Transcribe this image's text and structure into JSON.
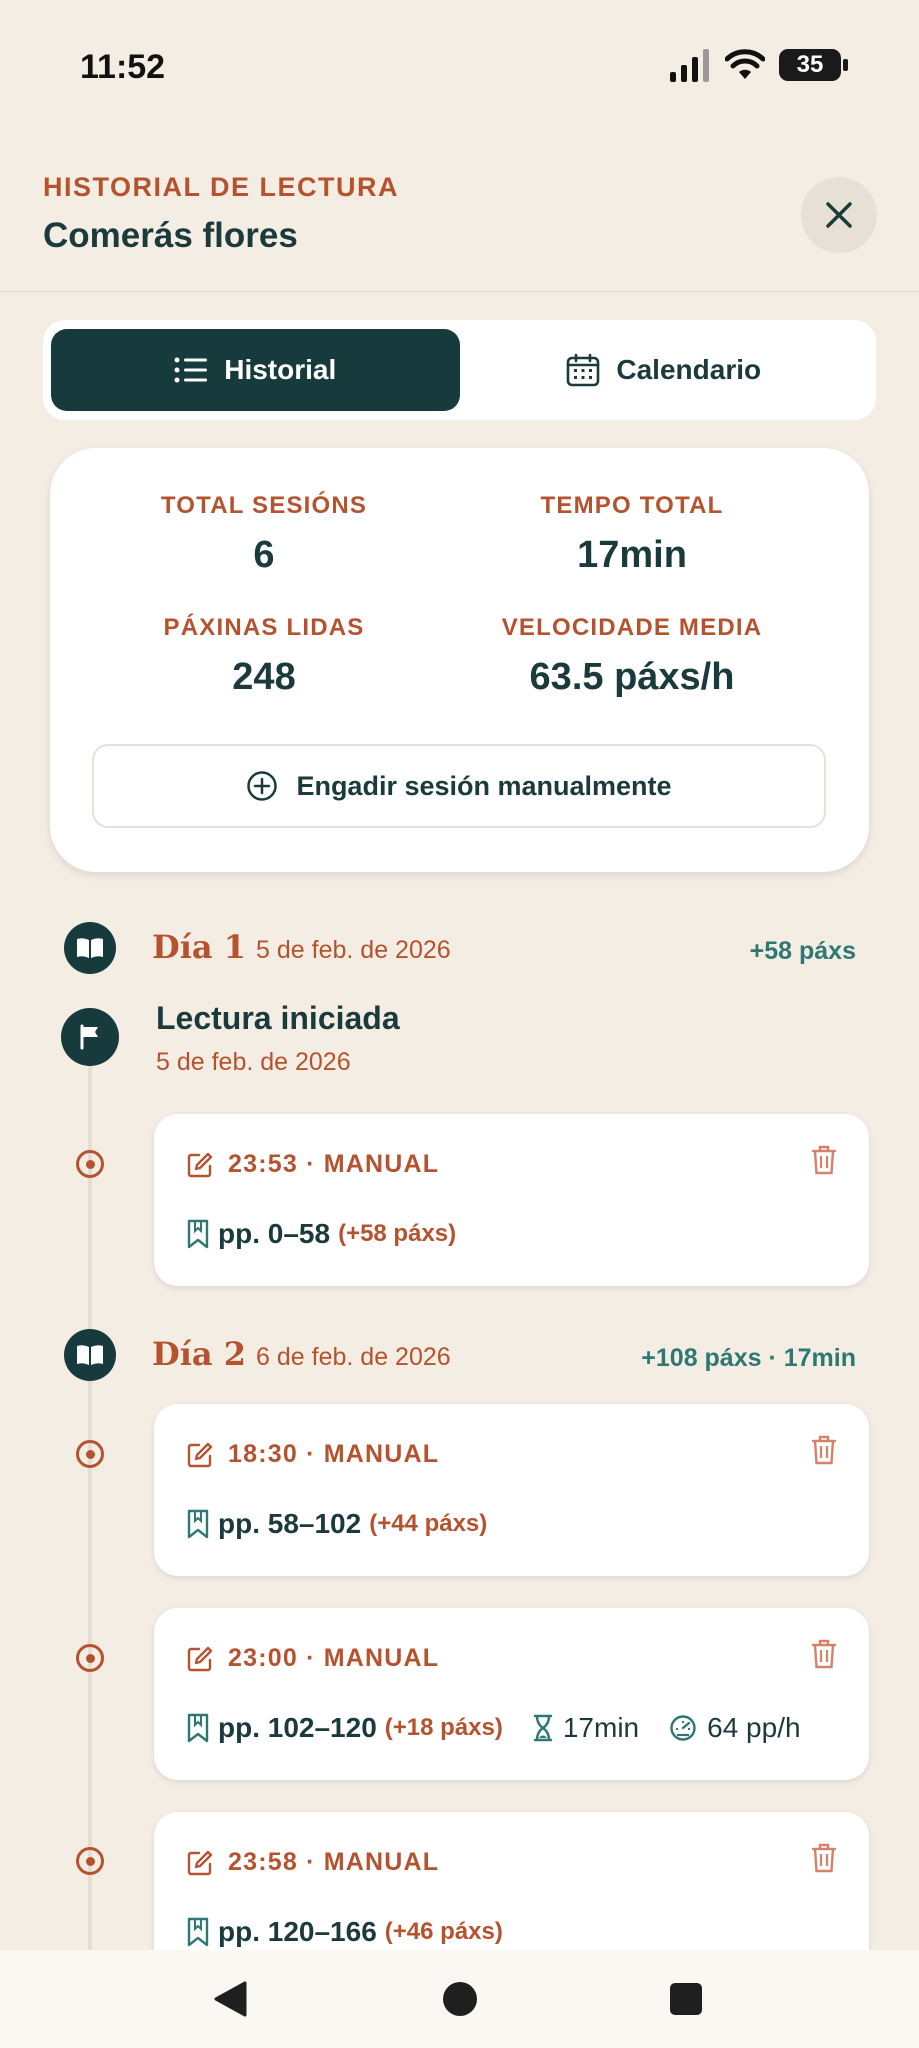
{
  "status_bar": {
    "time": "11:52",
    "battery": "35"
  },
  "header": {
    "kicker": "HISTORIAL DE LECTURA",
    "title": "Comerás flores"
  },
  "tabs": [
    {
      "label": "Historial",
      "icon": "list-icon",
      "active": true
    },
    {
      "label": "Calendario",
      "icon": "calendar-icon",
      "active": false
    }
  ],
  "stats": {
    "total_sessions": {
      "label": "TOTAL SESIÓNS",
      "value": "6"
    },
    "total_time": {
      "label": "TEMPO TOTAL",
      "value": "17min"
    },
    "pages_read": {
      "label": "PÁXINAS LIDAS",
      "value": "248"
    },
    "avg_speed": {
      "label": "VELOCIDADE MEDIA",
      "value": "63.5 páxs/h"
    }
  },
  "add_session_label": "Engadir sesión manualmente",
  "days": [
    {
      "title": "Día 1",
      "date": "5 de feb. de 2026",
      "summary": "+58 páxs",
      "start": {
        "title": "Lectura iniciada",
        "date": "5 de feb. de 2026"
      },
      "sessions": [
        {
          "header": "23:53 · MANUAL",
          "pages": "pp. 0–58",
          "delta": "(+58 páxs)"
        }
      ]
    },
    {
      "title": "Día 2",
      "date": "6 de feb. de 2026",
      "summary": "+108 páxs · 17min",
      "sessions": [
        {
          "header": "18:30 · MANUAL",
          "pages": "pp. 58–102",
          "delta": "(+44 páxs)"
        },
        {
          "header": "23:00 · MANUAL",
          "pages": "pp. 102–120",
          "delta": "(+18 páxs)",
          "duration": "17min",
          "speed": "64 pp/h"
        },
        {
          "header": "23:58 · MANUAL",
          "pages": "pp. 120–166",
          "delta": "(+46 páxs)"
        }
      ]
    }
  ],
  "colors": {
    "accent": "#b5532f",
    "dark": "#173a3d",
    "green": "#2e7872",
    "background": "#f4ede4"
  }
}
